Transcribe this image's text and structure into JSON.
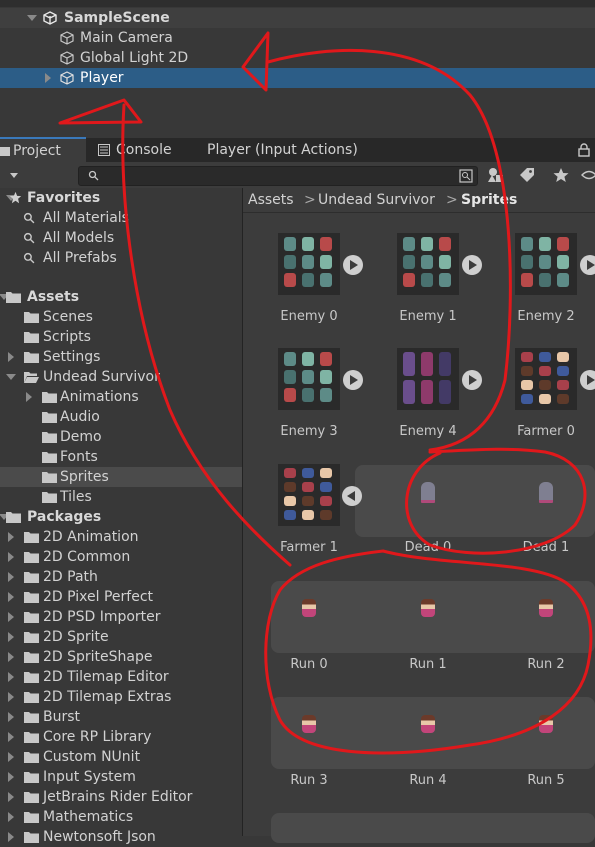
{
  "hierarchy": {
    "scene": "SampleScene",
    "items": [
      {
        "label": "Main Camera"
      },
      {
        "label": "Global Light 2D"
      },
      {
        "label": "Player"
      }
    ]
  },
  "tabs": [
    {
      "label": "Project"
    },
    {
      "label": "Console"
    },
    {
      "label": "Player (Input Actions)"
    }
  ],
  "favorites": {
    "header": "Favorites",
    "items": [
      "All Materials",
      "All Models",
      "All Prefabs"
    ]
  },
  "assets": {
    "header": "Assets",
    "items": [
      "Scenes",
      "Scripts",
      "Settings",
      "Undead Survivor"
    ],
    "undead_children": [
      "Animations",
      "Audio",
      "Demo",
      "Fonts",
      "Sprites",
      "Tiles"
    ]
  },
  "packages": {
    "header": "Packages",
    "items": [
      "2D Animation",
      "2D Common",
      "2D Path",
      "2D Pixel Perfect",
      "2D PSD Importer",
      "2D Sprite",
      "2D SpriteShape",
      "2D Tilemap Editor",
      "2D Tilemap Extras",
      "Burst",
      "Core RP Library",
      "Custom NUnit",
      "Input System",
      "JetBrains Rider Editor",
      "Mathematics",
      "Newtonsoft Json"
    ]
  },
  "breadcrumb": [
    "Assets",
    "Undead Survivor",
    "Sprites"
  ],
  "assets_grid": {
    "row1": [
      "Enemy 0",
      "Enemy 1",
      "Enemy 2"
    ],
    "row2": [
      "Enemy 3",
      "Enemy 4",
      "Farmer 0"
    ],
    "row3": [
      "Farmer 1",
      "Dead 0",
      "Dead 1"
    ],
    "row4": [
      "Run 0",
      "Run 1",
      "Run 2"
    ],
    "row5": [
      "Run 3",
      "Run 4",
      "Run 5"
    ]
  },
  "colors": {
    "selection": "#2c5d87",
    "annotation": "#e0181b",
    "panel": "#383838"
  }
}
